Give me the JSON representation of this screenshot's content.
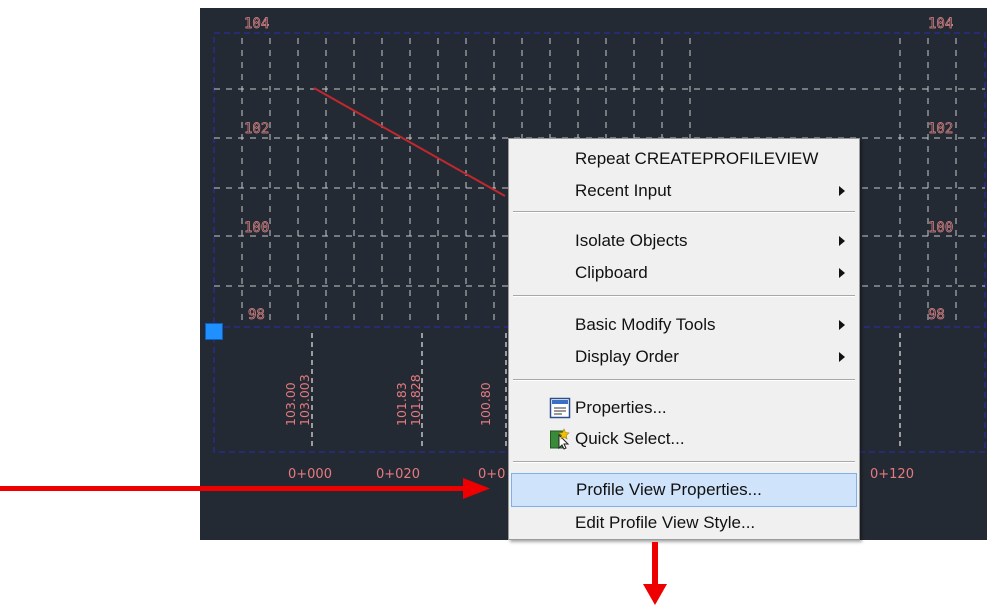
{
  "drawing": {
    "elevation_labels": {
      "top_left": "104",
      "top_right": "104",
      "r2_left": "102",
      "r2_right": "102",
      "r3_left": "100",
      "r3_right": "100",
      "r4_left": "98",
      "r4_right": "98"
    },
    "stations": [
      "0+000",
      "0+020",
      "0+0",
      "0+120"
    ],
    "elevation_pairs": [
      {
        "existing": "103.00",
        "design": "103.003"
      },
      {
        "existing": "101.83",
        "design": "101.828"
      },
      {
        "existing": "100.80",
        "design": ""
      }
    ],
    "colors": {
      "background": "#242a33",
      "grid": "#c8c8c8",
      "frame": "#2a2a8a",
      "text": "#e67a80",
      "profile_line": "#c0282e",
      "grip": "#1e90ff"
    }
  },
  "context_menu": {
    "items": [
      {
        "label": "Repeat CREATEPROFILEVIEW",
        "submenu": false
      },
      {
        "label": "Recent Input",
        "submenu": true
      },
      {
        "label": "Isolate Objects",
        "submenu": true
      },
      {
        "label": "Clipboard",
        "submenu": true
      },
      {
        "label": "Basic Modify Tools",
        "submenu": true
      },
      {
        "label": "Display Order",
        "submenu": true
      },
      {
        "label": "Properties...",
        "submenu": false,
        "icon": "properties-icon"
      },
      {
        "label": "Quick Select...",
        "submenu": false,
        "icon": "quick-select-icon"
      },
      {
        "label": "Profile View Properties...",
        "submenu": false,
        "highlighted": true
      },
      {
        "label": "Edit Profile View Style...",
        "submenu": false
      }
    ],
    "highlight_color": "#cfe3fb"
  },
  "annotations": {
    "arrow_color": "#ee0000",
    "arrows": [
      "pointer-arrow-right",
      "pointer-arrow-down"
    ]
  }
}
